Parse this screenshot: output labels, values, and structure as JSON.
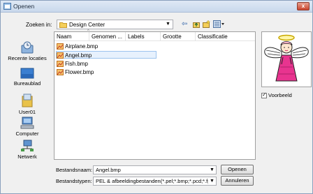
{
  "window": {
    "title": "Openen",
    "close_label": "x"
  },
  "lookin": {
    "label": "Zoeken in:",
    "value": "Design Center"
  },
  "places": [
    {
      "label": "Recente locaties",
      "icon": "recent-locations-icon"
    },
    {
      "label": "Bureaublad",
      "icon": "desktop-icon"
    },
    {
      "label": "User01",
      "icon": "user-folder-icon"
    },
    {
      "label": "Computer",
      "icon": "computer-icon"
    },
    {
      "label": "Netwerk",
      "icon": "network-icon"
    }
  ],
  "columns": [
    "Naam",
    "Genomen ...",
    "Labels",
    "Grootte",
    "Classificatie"
  ],
  "files": [
    {
      "name": "Airplane.bmp",
      "selected": false
    },
    {
      "name": "Angel.bmp",
      "selected": true
    },
    {
      "name": "Fish.bmp",
      "selected": false
    },
    {
      "name": "Flower.bmp",
      "selected": false
    }
  ],
  "preview": {
    "checkbox_label": "Voorbeeld",
    "checked": true,
    "image": "angel-preview"
  },
  "filename": {
    "label": "Bestandsnaam:",
    "value": "Angel.bmp"
  },
  "filetype": {
    "label": "Bestandstypen:",
    "value": "PEL & afbeeldingbestanden(*.pel;*.bmp;*.pcd;*.fpx;*.tif"
  },
  "buttons": {
    "open": "Openen",
    "cancel": "Annuleren"
  },
  "colors": {
    "accent": "#2b5fa6",
    "selection": "#e7f1fd"
  }
}
